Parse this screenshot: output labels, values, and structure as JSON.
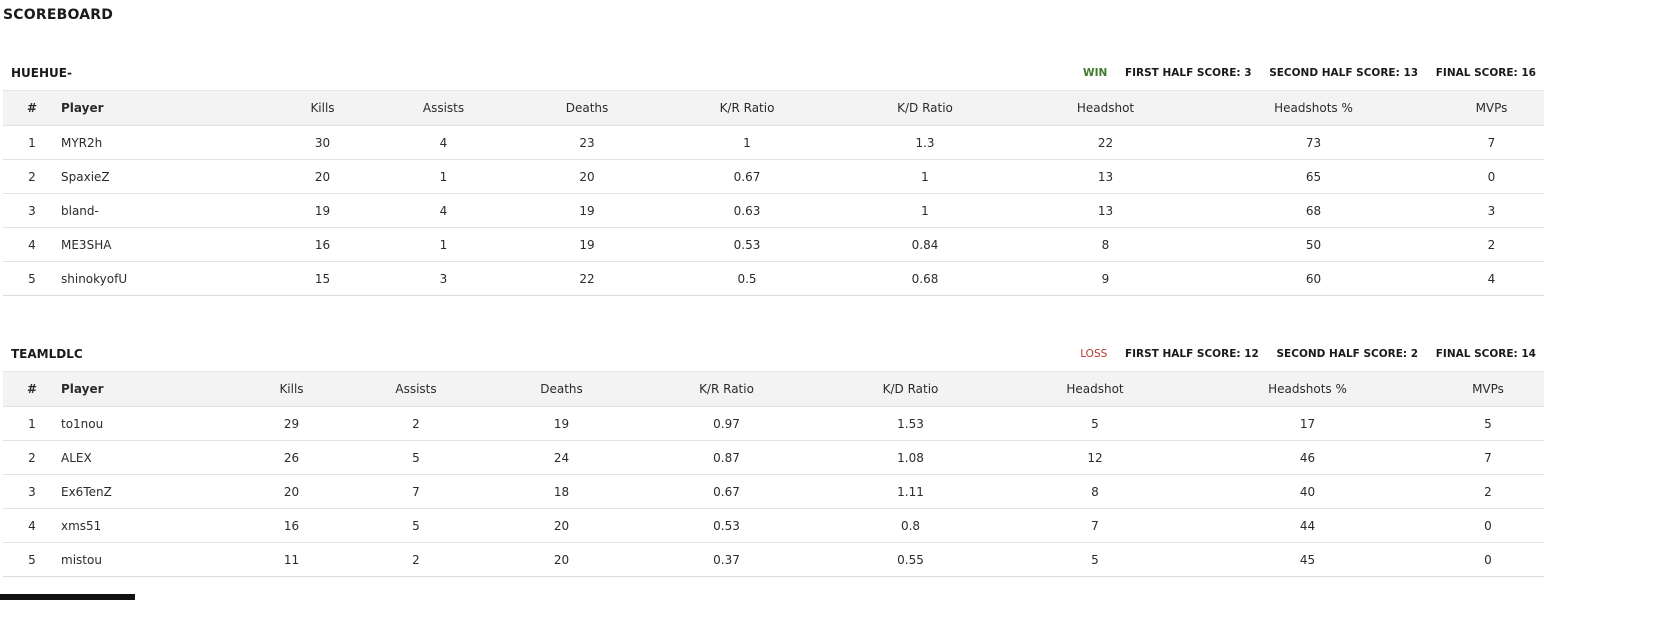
{
  "page": {
    "title": "SCOREBOARD"
  },
  "columns": [
    "#",
    "Player",
    "Kills",
    "Assists",
    "Deaths",
    "K/R Ratio",
    "K/D Ratio",
    "Headshot",
    "Headshots %",
    "MVPs"
  ],
  "teams": [
    {
      "name": "HUEHUE-",
      "result": "WIN",
      "first_half": "FIRST HALF SCORE: 3",
      "second_half": "SECOND HALF SCORE: 13",
      "final": "FINAL SCORE: 16",
      "result_color": "#3f7a2c",
      "rows": [
        [
          "1",
          "MYR2h",
          "30",
          "4",
          "23",
          "1",
          "1.3",
          "22",
          "73",
          "7"
        ],
        [
          "2",
          "SpaxieZ",
          "20",
          "1",
          "20",
          "0.67",
          "1",
          "13",
          "65",
          "0"
        ],
        [
          "3",
          "bland-",
          "19",
          "4",
          "19",
          "0.63",
          "1",
          "13",
          "68",
          "3"
        ],
        [
          "4",
          "ME3SHA",
          "16",
          "1",
          "19",
          "0.53",
          "0.84",
          "8",
          "50",
          "2"
        ],
        [
          "5",
          "shinokyofU",
          "15",
          "3",
          "22",
          "0.5",
          "0.68",
          "9",
          "60",
          "4"
        ]
      ]
    },
    {
      "name": "TEAMLDLC",
      "result": "LOSS",
      "first_half": "FIRST HALF SCORE: 12",
      "second_half": "SECOND HALF SCORE: 2",
      "final": "FINAL SCORE: 14",
      "result_color": "#b5372f",
      "rows": [
        [
          "1",
          "to1nou",
          "29",
          "2",
          "19",
          "0.97",
          "1.53",
          "5",
          "17",
          "5"
        ],
        [
          "2",
          "ALEX",
          "26",
          "5",
          "24",
          "0.87",
          "1.08",
          "12",
          "46",
          "7"
        ],
        [
          "3",
          "Ex6TenZ",
          "20",
          "7",
          "18",
          "0.67",
          "1.11",
          "8",
          "40",
          "2"
        ],
        [
          "4",
          "xms51",
          "16",
          "5",
          "20",
          "0.53",
          "0.8",
          "7",
          "44",
          "0"
        ],
        [
          "5",
          "mistou",
          "11",
          "2",
          "20",
          "0.37",
          "0.55",
          "5",
          "45",
          "0"
        ]
      ]
    }
  ]
}
